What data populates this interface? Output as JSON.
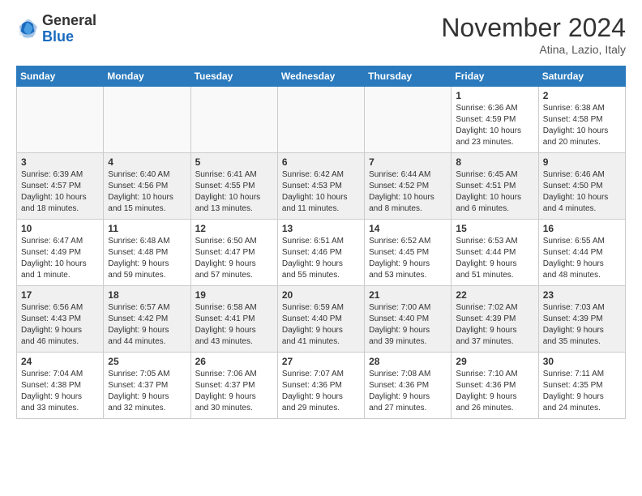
{
  "header": {
    "logo": {
      "general": "General",
      "blue": "Blue"
    },
    "title": "November 2024",
    "location": "Atina, Lazio, Italy"
  },
  "weekdays": [
    "Sunday",
    "Monday",
    "Tuesday",
    "Wednesday",
    "Thursday",
    "Friday",
    "Saturday"
  ],
  "weeks": [
    [
      {
        "day": "",
        "detail": ""
      },
      {
        "day": "",
        "detail": ""
      },
      {
        "day": "",
        "detail": ""
      },
      {
        "day": "",
        "detail": ""
      },
      {
        "day": "",
        "detail": ""
      },
      {
        "day": "1",
        "detail": "Sunrise: 6:36 AM\nSunset: 4:59 PM\nDaylight: 10 hours\nand 23 minutes."
      },
      {
        "day": "2",
        "detail": "Sunrise: 6:38 AM\nSunset: 4:58 PM\nDaylight: 10 hours\nand 20 minutes."
      }
    ],
    [
      {
        "day": "3",
        "detail": "Sunrise: 6:39 AM\nSunset: 4:57 PM\nDaylight: 10 hours\nand 18 minutes."
      },
      {
        "day": "4",
        "detail": "Sunrise: 6:40 AM\nSunset: 4:56 PM\nDaylight: 10 hours\nand 15 minutes."
      },
      {
        "day": "5",
        "detail": "Sunrise: 6:41 AM\nSunset: 4:55 PM\nDaylight: 10 hours\nand 13 minutes."
      },
      {
        "day": "6",
        "detail": "Sunrise: 6:42 AM\nSunset: 4:53 PM\nDaylight: 10 hours\nand 11 minutes."
      },
      {
        "day": "7",
        "detail": "Sunrise: 6:44 AM\nSunset: 4:52 PM\nDaylight: 10 hours\nand 8 minutes."
      },
      {
        "day": "8",
        "detail": "Sunrise: 6:45 AM\nSunset: 4:51 PM\nDaylight: 10 hours\nand 6 minutes."
      },
      {
        "day": "9",
        "detail": "Sunrise: 6:46 AM\nSunset: 4:50 PM\nDaylight: 10 hours\nand 4 minutes."
      }
    ],
    [
      {
        "day": "10",
        "detail": "Sunrise: 6:47 AM\nSunset: 4:49 PM\nDaylight: 10 hours\nand 1 minute."
      },
      {
        "day": "11",
        "detail": "Sunrise: 6:48 AM\nSunset: 4:48 PM\nDaylight: 9 hours\nand 59 minutes."
      },
      {
        "day": "12",
        "detail": "Sunrise: 6:50 AM\nSunset: 4:47 PM\nDaylight: 9 hours\nand 57 minutes."
      },
      {
        "day": "13",
        "detail": "Sunrise: 6:51 AM\nSunset: 4:46 PM\nDaylight: 9 hours\nand 55 minutes."
      },
      {
        "day": "14",
        "detail": "Sunrise: 6:52 AM\nSunset: 4:45 PM\nDaylight: 9 hours\nand 53 minutes."
      },
      {
        "day": "15",
        "detail": "Sunrise: 6:53 AM\nSunset: 4:44 PM\nDaylight: 9 hours\nand 51 minutes."
      },
      {
        "day": "16",
        "detail": "Sunrise: 6:55 AM\nSunset: 4:44 PM\nDaylight: 9 hours\nand 48 minutes."
      }
    ],
    [
      {
        "day": "17",
        "detail": "Sunrise: 6:56 AM\nSunset: 4:43 PM\nDaylight: 9 hours\nand 46 minutes."
      },
      {
        "day": "18",
        "detail": "Sunrise: 6:57 AM\nSunset: 4:42 PM\nDaylight: 9 hours\nand 44 minutes."
      },
      {
        "day": "19",
        "detail": "Sunrise: 6:58 AM\nSunset: 4:41 PM\nDaylight: 9 hours\nand 43 minutes."
      },
      {
        "day": "20",
        "detail": "Sunrise: 6:59 AM\nSunset: 4:40 PM\nDaylight: 9 hours\nand 41 minutes."
      },
      {
        "day": "21",
        "detail": "Sunrise: 7:00 AM\nSunset: 4:40 PM\nDaylight: 9 hours\nand 39 minutes."
      },
      {
        "day": "22",
        "detail": "Sunrise: 7:02 AM\nSunset: 4:39 PM\nDaylight: 9 hours\nand 37 minutes."
      },
      {
        "day": "23",
        "detail": "Sunrise: 7:03 AM\nSunset: 4:39 PM\nDaylight: 9 hours\nand 35 minutes."
      }
    ],
    [
      {
        "day": "24",
        "detail": "Sunrise: 7:04 AM\nSunset: 4:38 PM\nDaylight: 9 hours\nand 33 minutes."
      },
      {
        "day": "25",
        "detail": "Sunrise: 7:05 AM\nSunset: 4:37 PM\nDaylight: 9 hours\nand 32 minutes."
      },
      {
        "day": "26",
        "detail": "Sunrise: 7:06 AM\nSunset: 4:37 PM\nDaylight: 9 hours\nand 30 minutes."
      },
      {
        "day": "27",
        "detail": "Sunrise: 7:07 AM\nSunset: 4:36 PM\nDaylight: 9 hours\nand 29 minutes."
      },
      {
        "day": "28",
        "detail": "Sunrise: 7:08 AM\nSunset: 4:36 PM\nDaylight: 9 hours\nand 27 minutes."
      },
      {
        "day": "29",
        "detail": "Sunrise: 7:10 AM\nSunset: 4:36 PM\nDaylight: 9 hours\nand 26 minutes."
      },
      {
        "day": "30",
        "detail": "Sunrise: 7:11 AM\nSunset: 4:35 PM\nDaylight: 9 hours\nand 24 minutes."
      }
    ]
  ]
}
